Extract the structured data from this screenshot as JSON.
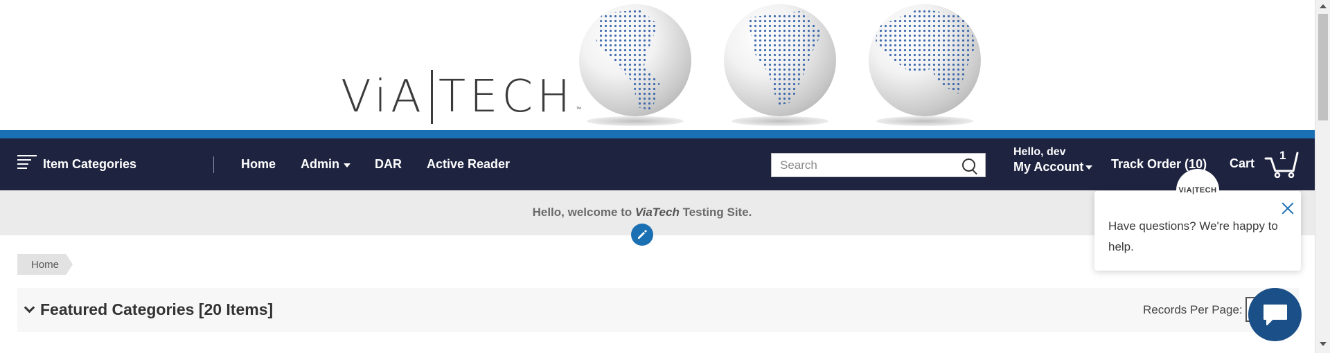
{
  "brand": {
    "logo_text_left": "ViA",
    "logo_text_right": "TECH",
    "trademark": "™"
  },
  "nav": {
    "categories_label": "Item Categories",
    "links": [
      {
        "label": "Home"
      },
      {
        "label": "Admin"
      },
      {
        "label": "DAR"
      },
      {
        "label": "Active Reader"
      }
    ],
    "search_placeholder": "Search",
    "greeting": "Hello, dev",
    "account_label": "My Account",
    "track_order_label": "Track Order (10)",
    "cart_label": "Cart",
    "cart_count": "1"
  },
  "welcome": {
    "prefix": "Hello, welcome to ",
    "site_name": "ViaTech",
    "suffix": " Testing Site."
  },
  "breadcrumb": {
    "items": [
      "Home"
    ]
  },
  "featured": {
    "title": "Featured Categories [20 Items]",
    "records_per_page_label": "Records Per Page:"
  },
  "chat": {
    "avatar_text": "ViA|TECH",
    "message": "Have questions? We're happy to help."
  },
  "colors": {
    "nav_bg": "#1e2340",
    "accent_blue": "#1b6fb3",
    "chat_button": "#1b4f87",
    "welcome_bg": "#ebebeb"
  }
}
